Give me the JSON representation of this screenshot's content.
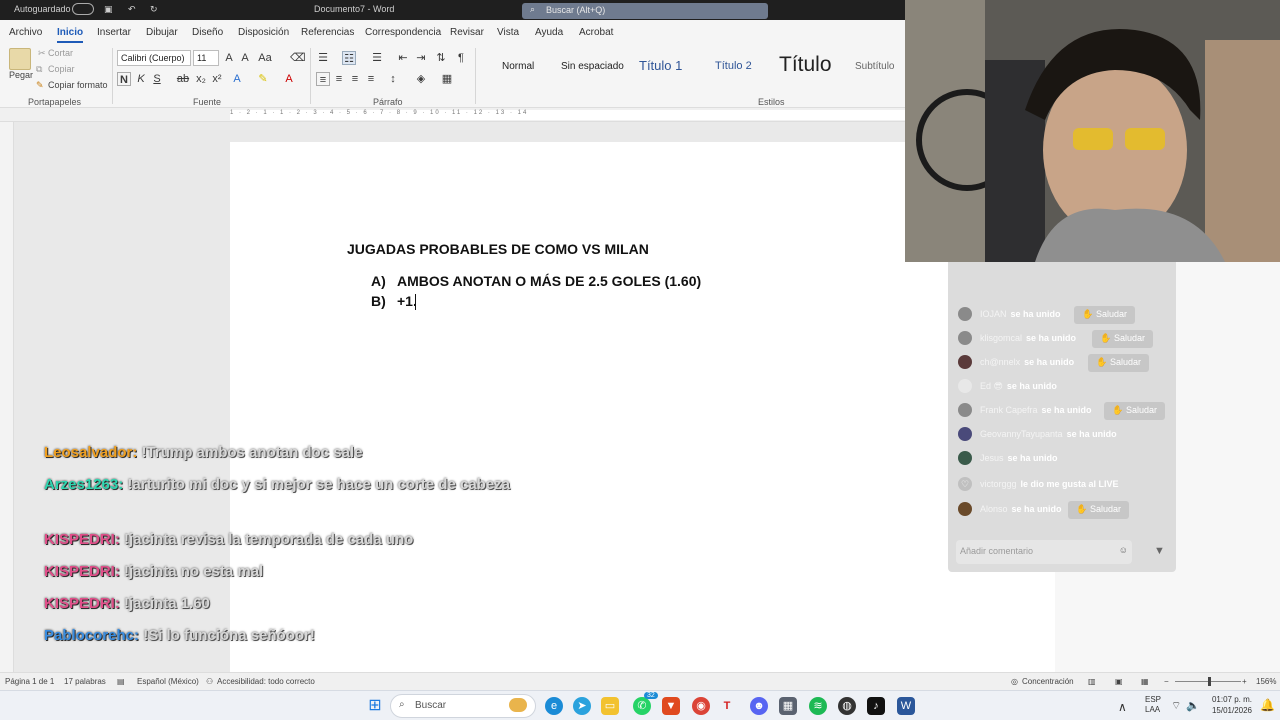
{
  "titlebar": {
    "autosave": "Autoguardado",
    "doc_title": "Documento7 - Word",
    "search": "Buscar (Alt+Q)"
  },
  "menu": [
    "Archivo",
    "Inicio",
    "Insertar",
    "Dibujar",
    "Diseño",
    "Disposición",
    "Referencias",
    "Correspondencia",
    "Revisar",
    "Vista",
    "Ayuda",
    "Acrobat"
  ],
  "ribbon": {
    "clipboard": {
      "paste": "Pegar",
      "cut": "Cortar",
      "copy": "Copiar",
      "format_painter": "Copiar formato",
      "label": "Portapapeles"
    },
    "font": {
      "name": "Calibri (Cuerpo)",
      "size": "11",
      "label": "Fuente"
    },
    "paragraph": {
      "label": "Párrafo"
    },
    "styles": {
      "label": "Estilos",
      "items": [
        "Normal",
        "Sin espaciado",
        "Título 1",
        "Título 2",
        "Título",
        "Subtítulo"
      ]
    }
  },
  "ruler": {
    "numbers": "1 · 2 · 1 · 1 · 2 · 3 · 4 · 5 · 6 · 7 · 8 · 9 · 10 · 11 · 12 · 13 · 14"
  },
  "document": {
    "title": "JUGADAS PROBABLES DE COMO VS MILAN",
    "items": [
      {
        "marker": "A)",
        "text": "AMBOS ANOTAN O MÁS DE 2.5 GOLES (1.60)"
      },
      {
        "marker": "B)",
        "text": "+1."
      }
    ]
  },
  "stream_chat": [
    {
      "user": "Leosalvador:",
      "text": "!Trump ambos anotan doc sale",
      "color": "#f0a020"
    },
    {
      "user": "Arzes1263:",
      "text": "!arturito mi doc y si mejor se hace un corte de cabeza",
      "color": "#2ed6b0"
    },
    {
      "user": "KISPEDRI:",
      "text": "!jacinta revisa la temporada de cada uno",
      "color": "#e0508a"
    },
    {
      "user": "KISPEDRI:",
      "text": "!jacinta no esta mal",
      "color": "#e0508a"
    },
    {
      "user": "KISPEDRI:",
      "text": "!jacinta 1.60",
      "color": "#e0508a"
    },
    {
      "user": "Pablocorehc:",
      "text": "!Si lo funcióna señóoor!",
      "color": "#3a8de0"
    }
  ],
  "live_panel": {
    "rows": [
      {
        "name": "IOJAN",
        "action": "se ha unido",
        "greet": true
      },
      {
        "name": "klisgomcal",
        "action": "se ha unido",
        "greet": true
      },
      {
        "name": "ch@nnelx",
        "action": "se ha unido",
        "greet": true
      },
      {
        "name": "Ed 😎",
        "action": "se ha unido",
        "greet": false
      },
      {
        "name": "Frank Capefra",
        "action": "se ha unido",
        "greet": true
      },
      {
        "name": "GeovannyTayupanta",
        "action": "se ha unido",
        "greet": false
      },
      {
        "name": "Jesus",
        "action": "se ha unido",
        "greet": false
      },
      {
        "name": "victorggg",
        "action": "le dio me gusta al LIVE",
        "greet": false
      },
      {
        "name": "Alonso",
        "action": "se ha unido",
        "greet": true
      }
    ],
    "greet_label": "Saludar",
    "comment_placeholder": "Añadir comentario"
  },
  "statusbar": {
    "page": "Página 1 de 1",
    "words": "17 palabras",
    "language": "Español (México)",
    "accessibility": "Accesibilidad: todo correcto",
    "focus": "Concentración",
    "zoom": "156%"
  },
  "taskbar": {
    "search": "Buscar",
    "whatsapp_badge": "32",
    "lang": "ESP",
    "lang2": "LAA",
    "time": "01:07 p. m.",
    "date": "15/01/2026"
  }
}
